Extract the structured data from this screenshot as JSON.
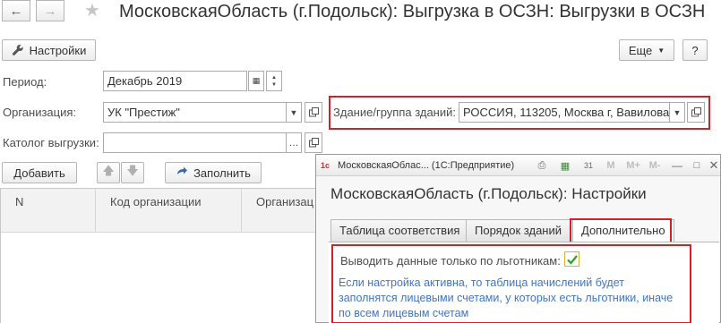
{
  "window": {
    "title": "МосковскаяОбласть (г.Подольск): Выгрузка в ОСЗН: Выгрузки в ОСЗН"
  },
  "toolbar": {
    "settings_label": "Настройки",
    "more_label": "Еще",
    "help_label": "?"
  },
  "form": {
    "period_label": "Период:",
    "period_value": "Декабрь 2019",
    "org_label": "Организация:",
    "org_value": "УК \"Престиж\"",
    "building_label": "Здание/группа зданий:",
    "building_value": "РОССИЯ, 113205, Москва г, Вавилова",
    "catalog_label": "Католог выгрузки:",
    "catalog_value": ""
  },
  "list_toolbar": {
    "add_label": "Добавить",
    "fill_label": "Заполнить"
  },
  "table": {
    "columns": [
      "N",
      "Код организации",
      "Организац"
    ]
  },
  "dialog": {
    "window_title": "МосковскаяОблас... (1С:Предприятие)",
    "heading": "МосковскаяОбласть (г.Подольск): Настройки",
    "tabs": [
      {
        "label": "Таблица соответствия",
        "active": false
      },
      {
        "label": "Порядок зданий",
        "active": false
      },
      {
        "label": "Дополнительно",
        "active": true
      }
    ],
    "checkbox_label": "Выводить данные только по льготникам:",
    "checkbox_checked": true,
    "hint": "Если настройка активна, то таблица начислений будет заполнятся лицевыми счетами, у которых есть льготники, иначе по всем лицевым счетам",
    "toolbar_icons": [
      "M",
      "M+",
      "M-"
    ]
  },
  "colors": {
    "highlight": "#d3212c",
    "hint_text": "#3f76c2",
    "checkmark": "#2e9e2e"
  }
}
